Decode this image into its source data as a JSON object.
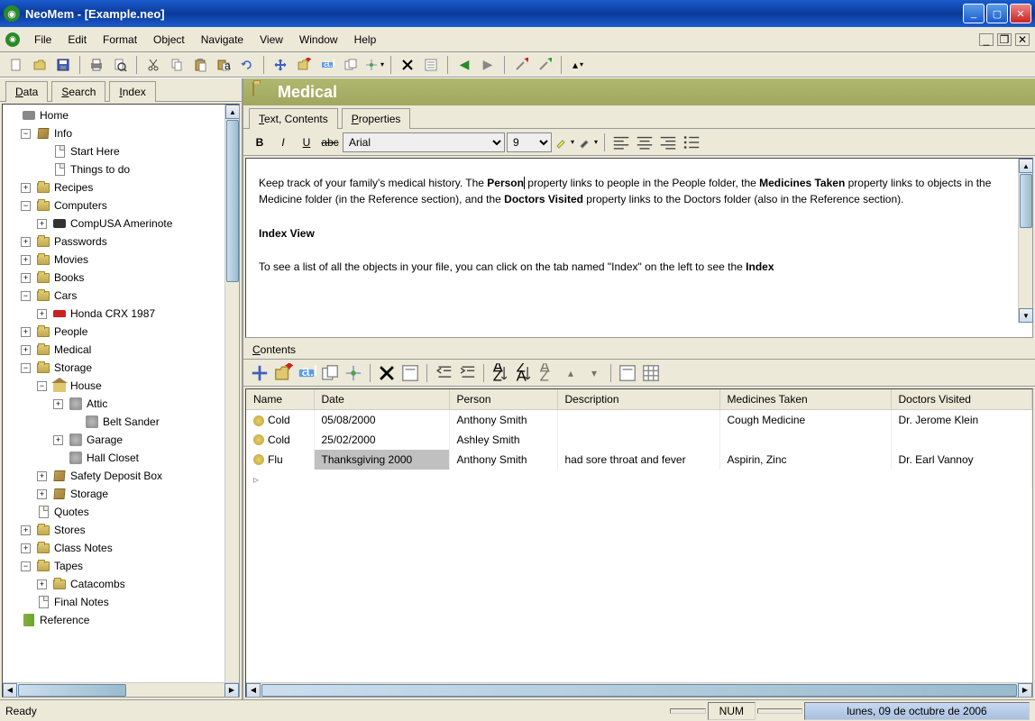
{
  "window": {
    "title": "NeoMem - [Example.neo]"
  },
  "menu": {
    "file": "File",
    "edit": "Edit",
    "format": "Format",
    "object": "Object",
    "navigate": "Navigate",
    "view": "View",
    "window": "Window",
    "help": "Help"
  },
  "sidetabs": {
    "data": "Data",
    "search": "Search",
    "index": "Index"
  },
  "tree": {
    "home": "Home",
    "info": "Info",
    "starthere": "Start Here",
    "thingstodo": "Things to do",
    "recipes": "Recipes",
    "computers": "Computers",
    "compusa": "CompUSA Amerinote",
    "passwords": "Passwords",
    "movies": "Movies",
    "books": "Books",
    "cars": "Cars",
    "honda": "Honda CRX 1987",
    "people": "People",
    "medical": "Medical",
    "storage": "Storage",
    "house": "House",
    "attic": "Attic",
    "beltsander": "Belt Sander",
    "garage": "Garage",
    "hallcloset": "Hall Closet",
    "safetydeposit": "Safety Deposit Box",
    "storage2": "Storage",
    "quotes": "Quotes",
    "stores": "Stores",
    "classnotes": "Class Notes",
    "tapes": "Tapes",
    "catacombs": "Catacombs",
    "finalnotes": "Final Notes",
    "reference": "Reference"
  },
  "header": {
    "title": "Medical"
  },
  "subtabs": {
    "text_contents": "Text, Contents",
    "properties": "Properties"
  },
  "editor": {
    "font": "Arial",
    "size": "9"
  },
  "body_text": {
    "p1a": "Keep track of your family's medical history. The ",
    "p1b": "Person",
    "p1c": " property links to people in the People folder, the ",
    "p1d": "Medicines Taken",
    "p1e": " property links to objects in the Medicine folder (in the Reference section), and the ",
    "p1f": "Doctors Visited",
    "p1g": " property links to the Doctors folder (also in the Reference section).",
    "h2": "Index View",
    "p2a": "To see a list of all the objects in your file, you can click on the tab named \"Index\" on the left to see the ",
    "p2b": "Index"
  },
  "contents_label": "Contents",
  "grid": {
    "headers": {
      "name": "Name",
      "date": "Date",
      "person": "Person",
      "description": "Description",
      "medicines": "Medicines Taken",
      "doctors": "Doctors Visited"
    },
    "rows": [
      {
        "name": "Cold",
        "date": "05/08/2000",
        "person": "Anthony Smith",
        "description": "",
        "medicines": "Cough Medicine",
        "doctors": "Dr. Jerome Klein"
      },
      {
        "name": "Cold",
        "date": "25/02/2000",
        "person": "Ashley Smith",
        "description": "",
        "medicines": "",
        "doctors": ""
      },
      {
        "name": "Flu",
        "date": "Thanksgiving 2000",
        "person": "Anthony Smith",
        "description": "had sore throat and fever",
        "medicines": "Aspirin, Zinc",
        "doctors": "Dr. Earl Vannoy"
      }
    ]
  },
  "status": {
    "ready": "Ready",
    "num": "NUM",
    "date": "lunes, 09 de octubre de 2006"
  }
}
